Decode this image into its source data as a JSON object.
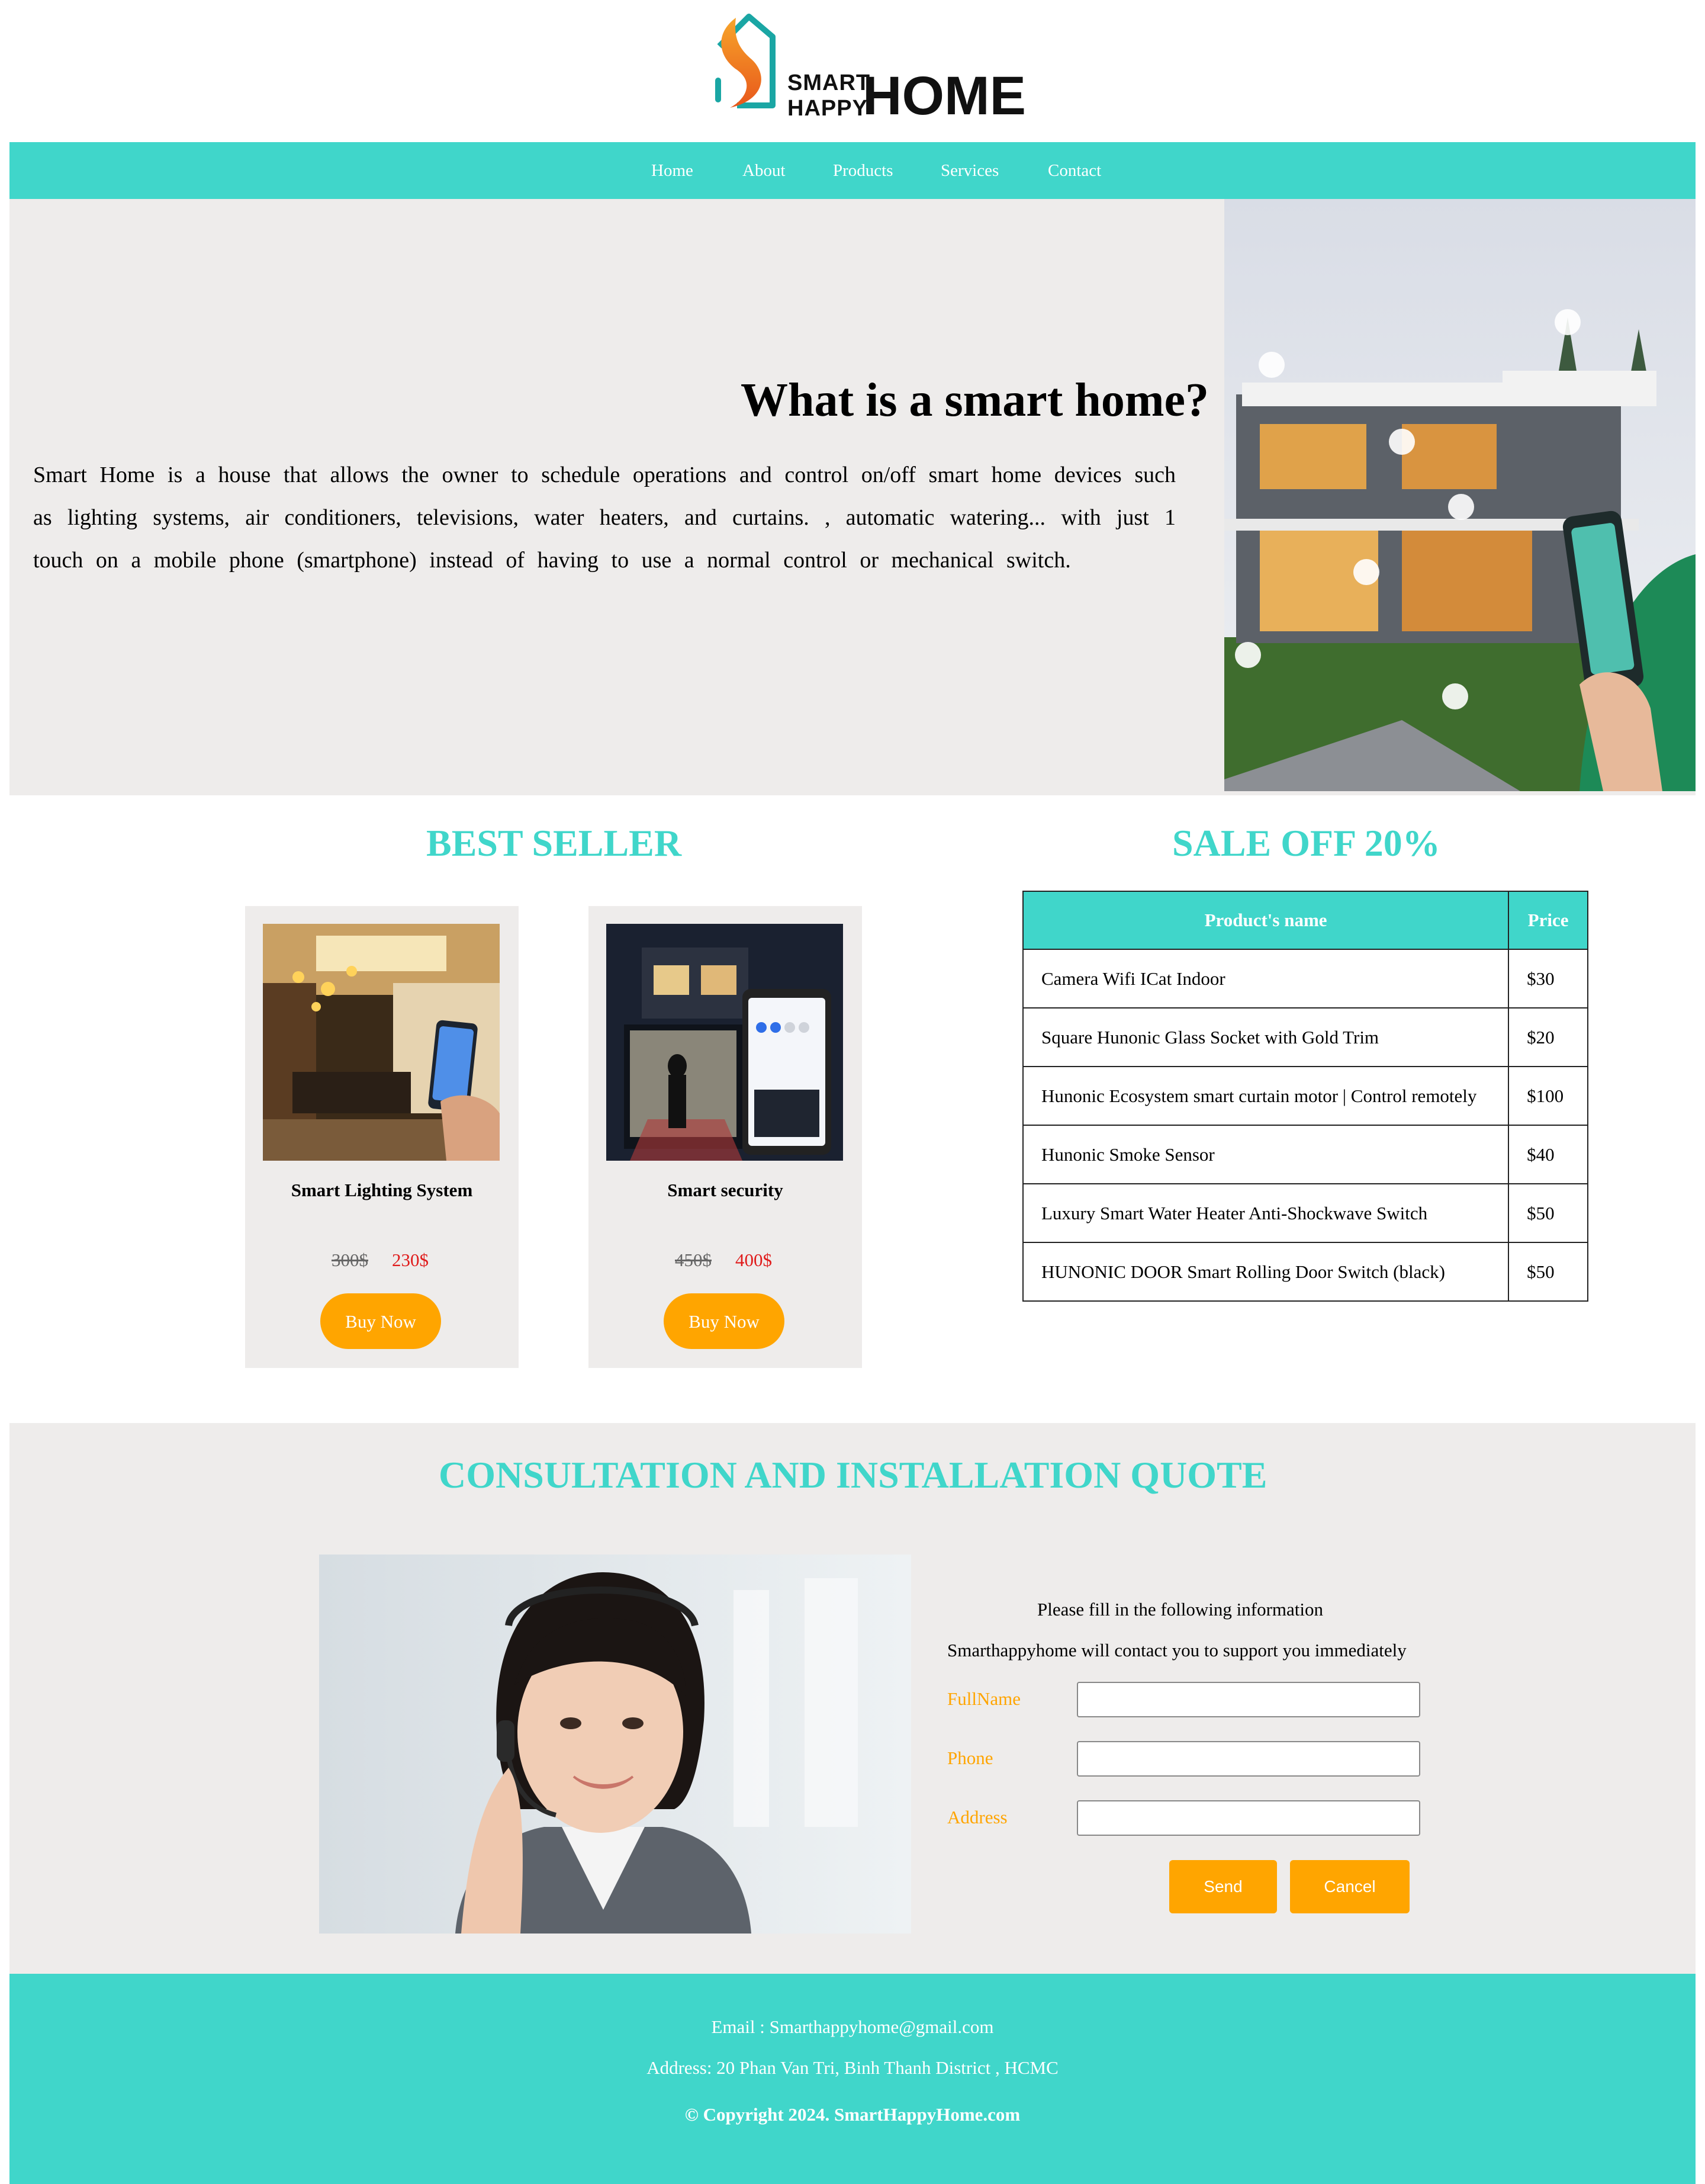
{
  "brand": {
    "logo_smart": "SMART",
    "logo_happy": "HAPPY",
    "logo_home": "HOME"
  },
  "nav": {
    "items": [
      "Home",
      "About",
      "Products",
      "Services",
      "Contact"
    ]
  },
  "hero": {
    "title": "What is a smart home?",
    "text": "Smart Home is a house that allows the owner to schedule operations and control on/off smart home devices such as lighting systems, air conditioners, televisions, water heaters, and curtains. , automatic watering... with just 1 touch on a mobile phone (smartphone) instead of having to use a normal control or mechanical switch."
  },
  "best_seller": {
    "title": "BEST SELLER",
    "products": [
      {
        "name": "Smart Lighting System",
        "old_price": "300$",
        "new_price": "230$",
        "button": "Buy Now"
      },
      {
        "name": "Smart security",
        "old_price": "450$",
        "new_price": "400$",
        "button": "Buy Now"
      }
    ]
  },
  "sale": {
    "title": "SALE OFF 20%",
    "headers": {
      "name": "Product's name",
      "price": "Price"
    },
    "rows": [
      {
        "name": "Camera Wifi ICat Indoor",
        "price": "$30"
      },
      {
        "name": "Square Hunonic Glass Socket with Gold Trim",
        "price": "$20"
      },
      {
        "name": "Hunonic Ecosystem smart curtain motor | Control remotely",
        "price": "$100"
      },
      {
        "name": "Hunonic Smoke Sensor",
        "price": "$40"
      },
      {
        "name": "Luxury Smart Water Heater Anti-Shockwave Switch",
        "price": "$50"
      },
      {
        "name": "HUNONIC DOOR Smart Rolling Door Switch (black)",
        "price": "$50"
      }
    ]
  },
  "consult": {
    "title": "CONSULTATION AND INSTALLATION QUOTE",
    "line1": "Please fill in the following information",
    "line2": "Smarthappyhome will contact you to support you immediately",
    "fields": {
      "fullname": "FullName",
      "phone": "Phone",
      "address": "Address"
    },
    "send": "Send",
    "cancel": "Cancel"
  },
  "footer": {
    "email": "Email : Smarthappyhome@gmail.com",
    "address": "Address: 20 Phan Van Tri, Binh Thanh District , HCMC",
    "copyright": "© Copyright 2024. SmartHappyHome.com"
  },
  "colors": {
    "accent": "#40d6ca",
    "orange": "#ffa500",
    "panel": "#eeeceb",
    "sale_price": "#e01b1b"
  }
}
